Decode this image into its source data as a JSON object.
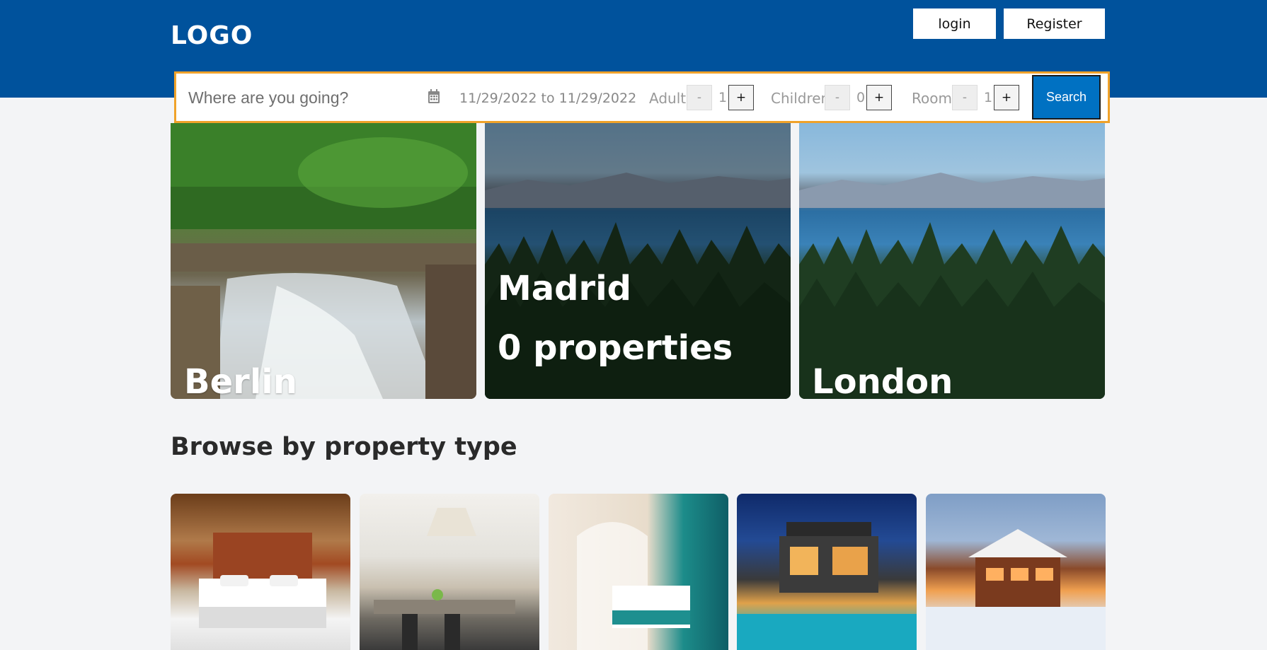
{
  "header": {
    "logo": "LOGO",
    "login_label": "login",
    "register_label": "Register"
  },
  "search": {
    "placeholder": "Where are you going?",
    "date_range": "11/29/2022 to 11/29/2022",
    "adult_label": "Adult",
    "adult_count": "1",
    "children_label": "Children",
    "children_count": "0",
    "room_label": "Room",
    "room_count": "1",
    "decrement_label": "-",
    "increment_label": "+",
    "search_label": "Search"
  },
  "featured": [
    {
      "name": "Berlin"
    },
    {
      "name": "Madrid",
      "properties": "0 properties"
    },
    {
      "name": "London"
    }
  ],
  "property_types": {
    "title": "Browse by property type"
  },
  "colors": {
    "header_bg": "#00529c",
    "accent_border": "#f0a22a",
    "search_button": "#0071c2"
  },
  "icons": {
    "calendar": "calendar-icon"
  }
}
